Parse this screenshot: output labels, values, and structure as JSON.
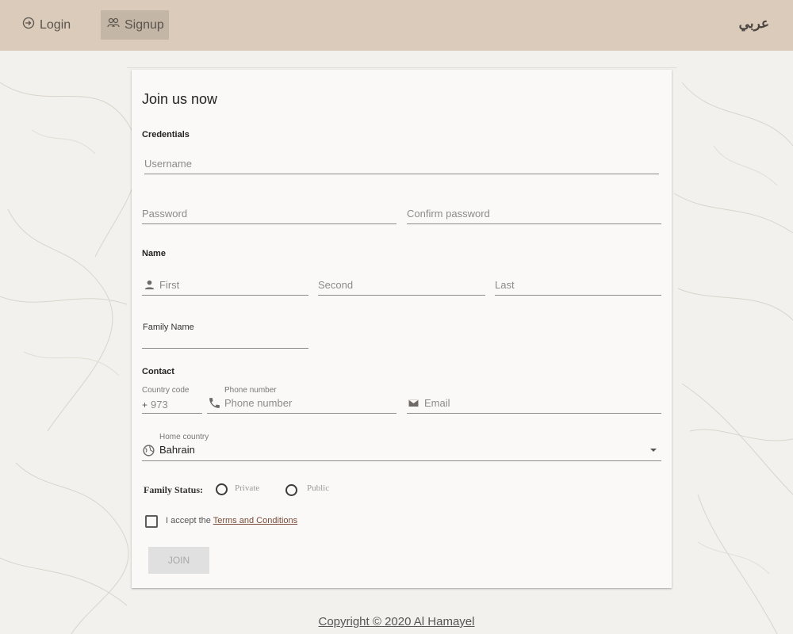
{
  "nav": {
    "login_label": "Login",
    "signup_label": "Signup",
    "language_label": "عربي"
  },
  "form": {
    "title": "Join us now",
    "credentials": {
      "section_label": "Credentials",
      "username_placeholder": "Username",
      "password_placeholder": "Password",
      "confirm_password_placeholder": "Confirm password"
    },
    "name": {
      "section_label": "Name",
      "first_placeholder": "First",
      "second_placeholder": "Second",
      "last_placeholder": "Last",
      "family_name_label": "Family Name"
    },
    "contact": {
      "section_label": "Contact",
      "country_code_label": "Country code",
      "country_code_prefix": "+",
      "country_code_placeholder": "973",
      "phone_label": "Phone number",
      "phone_placeholder": "Phone number",
      "email_placeholder": "Email",
      "home_country_label": "Home country",
      "home_country_value": "Bahrain"
    },
    "family_status": {
      "label": "Family Status:",
      "options": [
        "Private",
        "Public"
      ]
    },
    "terms": {
      "prefix": "I accept the",
      "link_text": "Terms and Conditions"
    },
    "join_label": "JOIN"
  },
  "footer": {
    "copyright": "Copyright © 2020 Al Hamayel"
  },
  "colors": {
    "topbar": "#dacbba",
    "active_nav": "#c3b6a6",
    "page_bg": "#f3f1ed",
    "card_bg": "#faf9f7",
    "link": "#7a4b3a"
  },
  "icons": [
    "login-icon",
    "signup-icon",
    "person-icon",
    "phone-icon",
    "email-icon",
    "globe-icon",
    "dropdown-arrow-icon"
  ]
}
